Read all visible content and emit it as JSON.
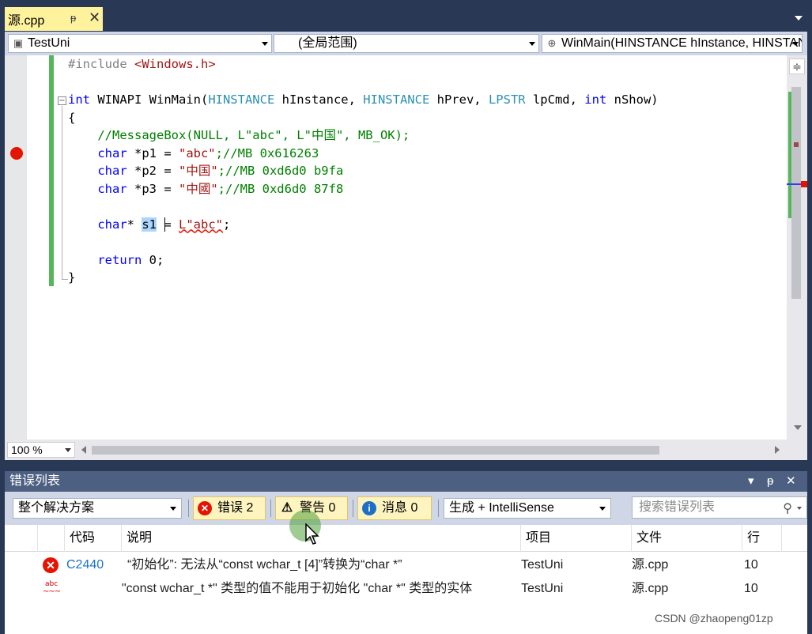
{
  "tab": {
    "title": "源.cpp",
    "pin_glyph": "ᵽ",
    "close_glyph": "✕"
  },
  "navbar": {
    "project": "TestUni",
    "scope": "(全局范围)",
    "member": "WinMain(HINSTANCE hInstance, HINSTANCE hPrev, LPSTR lpCmd, int nShow)"
  },
  "code": {
    "line1_pp": "#include ",
    "line1_inc": "<Windows.h>",
    "line3_int": "int ",
    "line3_winapi": "WINAPI WinMain(",
    "line3_t1": "HINSTANCE",
    "line3_a1": " hInstance, ",
    "line3_t2": "HINSTANCE",
    "line3_a2": " hPrev, ",
    "line3_t3": "LPSTR",
    "line3_a3": " lpCmd, ",
    "line3_t4": "int",
    "line3_a4": " nShow)",
    "line4": "{",
    "line5_comment": "//MessageBox(NULL, L\"abc\", L\"中国\", MB_OK);",
    "line6_kw": "char",
    "line6_decl": " *p1 = ",
    "line6_str": "\"abc\"",
    "line6_comment": ";//MB 0x616263",
    "line7_kw": "char",
    "line7_decl": " *p2 = ",
    "line7_str": "\"中国\"",
    "line7_comment": ";//MB 0xd6d0 b9fa",
    "line8_kw": "char",
    "line8_decl": " *p3 = ",
    "line8_str": "\"中國\"",
    "line8_comment": ";//MB 0xd6d0 87f8",
    "line10_kw": "char",
    "line10_star": "* ",
    "line10_var": "s1",
    "line10_eq": " = ",
    "line10_str": "L\"abc\"",
    "line10_end": ";",
    "line12_kw": "return",
    "line12_rest": " 0;",
    "line13": "}"
  },
  "editor": {
    "zoom": "100 %",
    "split_glyph": "≑"
  },
  "error_list": {
    "title": "错误列表",
    "title_controls": [
      "▾",
      "ᵽ",
      "✕"
    ],
    "scope_filter": "整个解决方案",
    "errors_label": "错误 2",
    "warnings_label": "警告 0",
    "messages_label": "消息 0",
    "source_filter": "生成 + IntelliSense",
    "search_placeholder": "搜索错误列表",
    "columns": [
      "代码",
      "说明",
      "项目",
      "文件",
      "行"
    ],
    "rows": [
      {
        "code": "C2440",
        "description": "“初始化”: 无法从“const wchar_t [4]”转换为“char *”",
        "project": "TestUni",
        "file": "源.cpp",
        "line": "10"
      },
      {
        "code": "",
        "description": "\"const wchar_t *\" 类型的值不能用于初始化 \"char *\" 类型的实体",
        "project": "TestUni",
        "file": "源.cpp",
        "line": "10"
      }
    ]
  },
  "watermark": "CSDN @zhaopeng01zp",
  "colors": {
    "accent": "#293955",
    "breakpoint": "#e51400",
    "change_bar": "#57b65b",
    "tab_active": "#fff29d"
  }
}
